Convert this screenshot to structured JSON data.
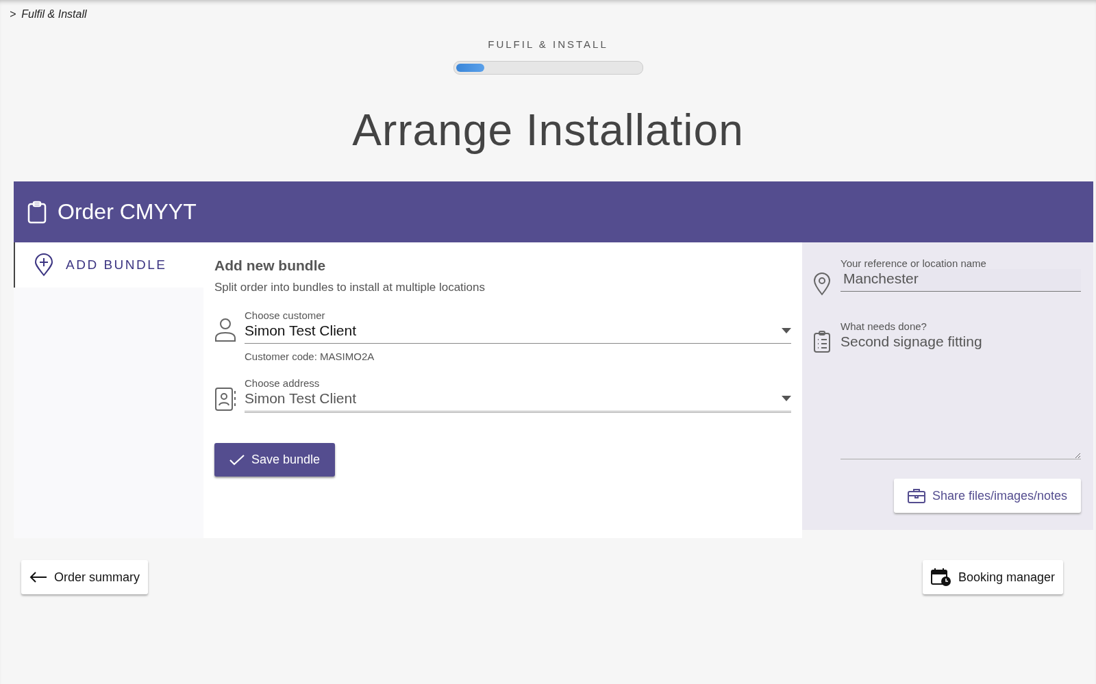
{
  "breadcrumb": {
    "separator": ">",
    "current": "Fulfil & Install"
  },
  "progress": {
    "label": "FULFIL & INSTALL",
    "level": 0.15
  },
  "page_title": "Arrange Installation",
  "order": {
    "title": "Order CMYYT"
  },
  "sidebar": {
    "items": [
      {
        "label": "ADD BUNDLE",
        "selected": true
      }
    ]
  },
  "form": {
    "heading": "Add new bundle",
    "description": "Split order into bundles to install at multiple locations",
    "fields": [
      {
        "kind": "customer",
        "label": "Choose customer",
        "value": "Simon Test Client",
        "hint": "Customer code: MASIMO2A"
      },
      {
        "kind": "address",
        "label": "Choose address",
        "value": "Simon Test Client"
      }
    ],
    "save_button": "Save bundle"
  },
  "details": {
    "reference": {
      "label": "Your reference or location name",
      "value": "Manchester"
    },
    "task": {
      "label": "What needs done?",
      "value": "Second signage fitting"
    },
    "share_button": "Share files/images/notes"
  },
  "footer": {
    "back_button": "Order summary",
    "booking_button": "Booking manager"
  }
}
